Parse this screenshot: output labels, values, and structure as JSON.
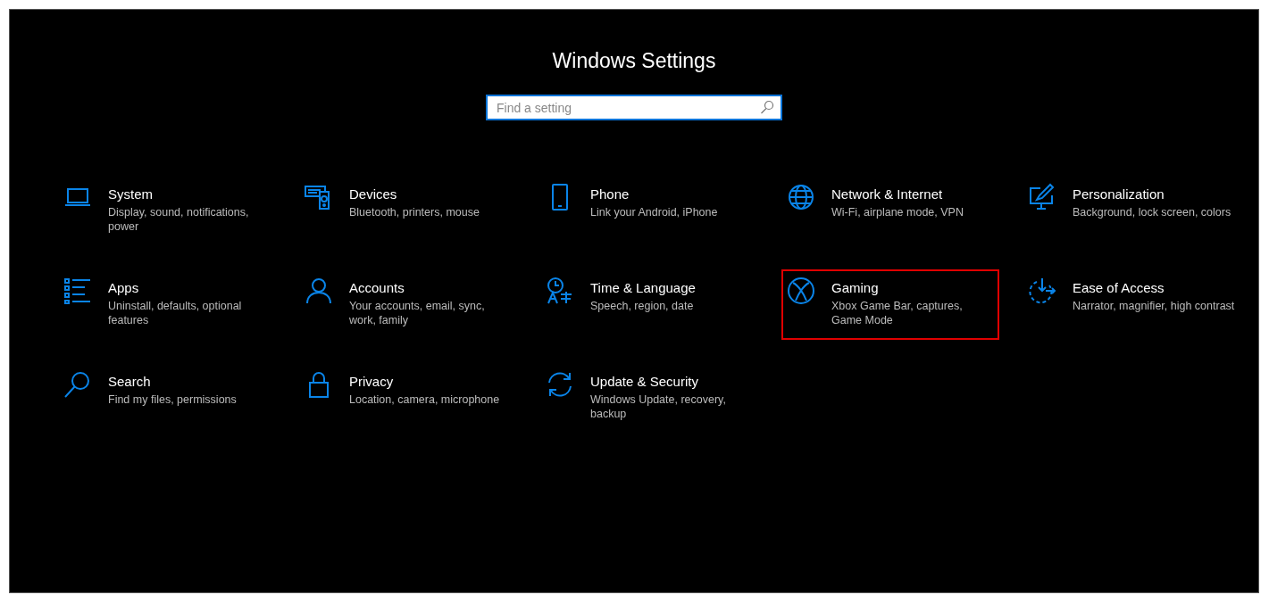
{
  "window": {
    "title": "Windows Settings"
  },
  "search": {
    "placeholder": "Find a setting"
  },
  "categories": [
    {
      "title": "System",
      "description": "Display, sound, notifications, power",
      "highlighted": false
    },
    {
      "title": "Devices",
      "description": "Bluetooth, printers, mouse",
      "highlighted": false
    },
    {
      "title": "Phone",
      "description": "Link your Android, iPhone",
      "highlighted": false
    },
    {
      "title": "Network & Internet",
      "description": "Wi-Fi, airplane mode, VPN",
      "highlighted": false
    },
    {
      "title": "Personalization",
      "description": "Background, lock screen, colors",
      "highlighted": false
    },
    {
      "title": "Apps",
      "description": "Uninstall, defaults, optional features",
      "highlighted": false
    },
    {
      "title": "Accounts",
      "description": "Your accounts, email, sync, work, family",
      "highlighted": false
    },
    {
      "title": "Time & Language",
      "description": "Speech, region, date",
      "highlighted": false
    },
    {
      "title": "Gaming",
      "description": "Xbox Game Bar, captures, Game Mode",
      "highlighted": true
    },
    {
      "title": "Ease of Access",
      "description": "Narrator, magnifier, high contrast",
      "highlighted": false
    },
    {
      "title": "Search",
      "description": "Find my files, permissions",
      "highlighted": false
    },
    {
      "title": "Privacy",
      "description": "Location, camera, microphone",
      "highlighted": false
    },
    {
      "title": "Update & Security",
      "description": "Windows Update, recovery, backup",
      "highlighted": false
    }
  ]
}
